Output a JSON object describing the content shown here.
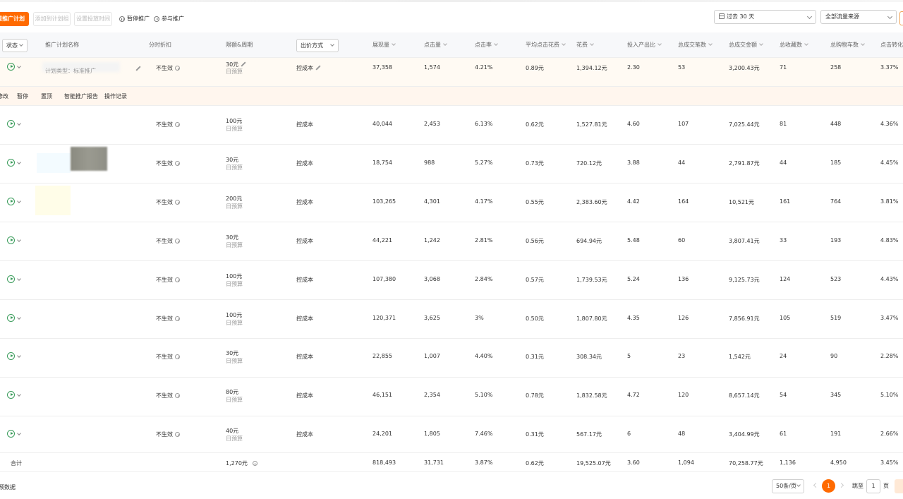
{
  "toolbar": {
    "new_plan": "提推广计划",
    "add_to_group": "添加到计划组",
    "set_time": "设置投放时间",
    "pause": "暂停推广",
    "join": "参与推广",
    "date_range": "过去 30 天",
    "traffic_source": "全部流量来源"
  },
  "headers": {
    "status": "状态",
    "plan_name": "推广计划名称",
    "discount": "分时折扣",
    "limit": "限额&周期",
    "bid": "出价方式",
    "impressions": "展现量",
    "clicks": "点击量",
    "ctr": "点击率",
    "cpc": "平均点击花费",
    "cost": "花费",
    "roi": "投入产出比",
    "orders": "总成交笔数",
    "gmv": "总成交金额",
    "favorites": "总收藏数",
    "cart": "总购物车数",
    "cvr": "点击转化率"
  },
  "row_actions": {
    "a0": "修改",
    "a1": "暂停",
    "a2": "置顶",
    "a3": "智能推广报告",
    "a4": "操作记录"
  },
  "rows": [
    {
      "name": "计划类型：标准推广",
      "discount": "不生效",
      "limit": "30元",
      "period": "日预算",
      "bid": "控成本",
      "impressions": "37,358",
      "clicks": "1,574",
      "ctr": "4.21%",
      "cpc": "0.89元",
      "cost": "1,394.12元",
      "roi": "2.30",
      "orders": "53",
      "gmv": "3,200.43元",
      "favorites": "71",
      "cart": "258",
      "cvr": "3.37%"
    },
    {
      "name": "",
      "discount": "不生效",
      "limit": "100元",
      "period": "日预算",
      "bid": "控成本",
      "impressions": "40,044",
      "clicks": "2,453",
      "ctr": "6.13%",
      "cpc": "0.62元",
      "cost": "1,527.81元",
      "roi": "4.60",
      "orders": "107",
      "gmv": "7,025.44元",
      "favorites": "81",
      "cart": "448",
      "cvr": "4.36%"
    },
    {
      "name": "",
      "discount": "不生效",
      "limit": "30元",
      "period": "日预算",
      "bid": "控成本",
      "impressions": "18,754",
      "clicks": "988",
      "ctr": "5.27%",
      "cpc": "0.73元",
      "cost": "720.12元",
      "roi": "3.88",
      "orders": "44",
      "gmv": "2,791.87元",
      "favorites": "44",
      "cart": "185",
      "cvr": "4.45%"
    },
    {
      "name": "",
      "discount": "不生效",
      "limit": "200元",
      "period": "日预算",
      "bid": "控成本",
      "impressions": "103,265",
      "clicks": "4,301",
      "ctr": "4.17%",
      "cpc": "0.55元",
      "cost": "2,383.60元",
      "roi": "4.42",
      "orders": "164",
      "gmv": "10,521元",
      "favorites": "161",
      "cart": "764",
      "cvr": "3.81%"
    },
    {
      "name": "",
      "discount": "不生效",
      "limit": "30元",
      "period": "日预算",
      "bid": "控成本",
      "impressions": "44,221",
      "clicks": "1,242",
      "ctr": "2.81%",
      "cpc": "0.56元",
      "cost": "694.94元",
      "roi": "5.48",
      "orders": "60",
      "gmv": "3,807.41元",
      "favorites": "33",
      "cart": "193",
      "cvr": "4.83%"
    },
    {
      "name": "",
      "discount": "不生效",
      "limit": "100元",
      "period": "日预算",
      "bid": "控成本",
      "impressions": "107,380",
      "clicks": "3,068",
      "ctr": "2.84%",
      "cpc": "0.57元",
      "cost": "1,739.53元",
      "roi": "5.24",
      "orders": "136",
      "gmv": "9,125.73元",
      "favorites": "124",
      "cart": "523",
      "cvr": "4.43%"
    },
    {
      "name": "",
      "discount": "不生效",
      "limit": "100元",
      "period": "日预算",
      "bid": "控成本",
      "impressions": "120,371",
      "clicks": "3,625",
      "ctr": "3%",
      "cpc": "0.50元",
      "cost": "1,807.80元",
      "roi": "4.35",
      "orders": "126",
      "gmv": "7,856.91元",
      "favorites": "105",
      "cart": "519",
      "cvr": "3.47%"
    },
    {
      "name": "",
      "discount": "不生效",
      "limit": "30元",
      "period": "日预算",
      "bid": "控成本",
      "impressions": "22,855",
      "clicks": "1,007",
      "ctr": "4.40%",
      "cpc": "0.31元",
      "cost": "308.34元",
      "roi": "5",
      "orders": "23",
      "gmv": "1,542元",
      "favorites": "24",
      "cart": "90",
      "cvr": "2.28%"
    },
    {
      "name": "",
      "discount": "不生效",
      "limit": "80元",
      "period": "日预算",
      "bid": "控成本",
      "impressions": "46,151",
      "clicks": "2,354",
      "ctr": "5.10%",
      "cpc": "0.78元",
      "cost": "1,832.58元",
      "roi": "4.72",
      "orders": "120",
      "gmv": "8,657.14元",
      "favorites": "54",
      "cart": "345",
      "cvr": "5.10%"
    },
    {
      "name": "",
      "discount": "不生效",
      "limit": "40元",
      "period": "日预算",
      "bid": "控成本",
      "impressions": "24,201",
      "clicks": "1,805",
      "ctr": "7.46%",
      "cpc": "0.31元",
      "cost": "567.17元",
      "roi": "6",
      "orders": "48",
      "gmv": "3,404.99元",
      "favorites": "61",
      "cart": "191",
      "cvr": "2.66%"
    }
  ],
  "total": {
    "label": "合计",
    "limit": "1,270元",
    "impressions": "818,493",
    "clicks": "31,731",
    "ctr": "3.87%",
    "cpc": "0.62元",
    "cost": "19,525.07元",
    "roi": "3.60",
    "orders": "1,094",
    "gmv": "70,258.77元",
    "favorites": "1,136",
    "cart": "4,950",
    "cvr": "3.45%"
  },
  "footer": {
    "left_text": "预数据",
    "page_size": "50条/页",
    "current_page": "1",
    "jump_label": "跳至",
    "jump_value": "1",
    "page_unit": "页"
  }
}
